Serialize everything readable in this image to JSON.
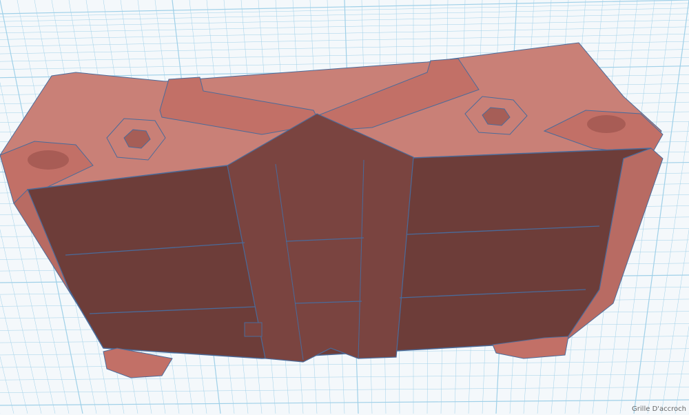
{
  "viewport": {
    "snap_grid_label": "Grille D'accroch",
    "colors": {
      "grid": "#9fd0e8",
      "model_face": "#6b3a36",
      "model_top": "#c97b72",
      "edge": "#4a6b9a"
    }
  }
}
